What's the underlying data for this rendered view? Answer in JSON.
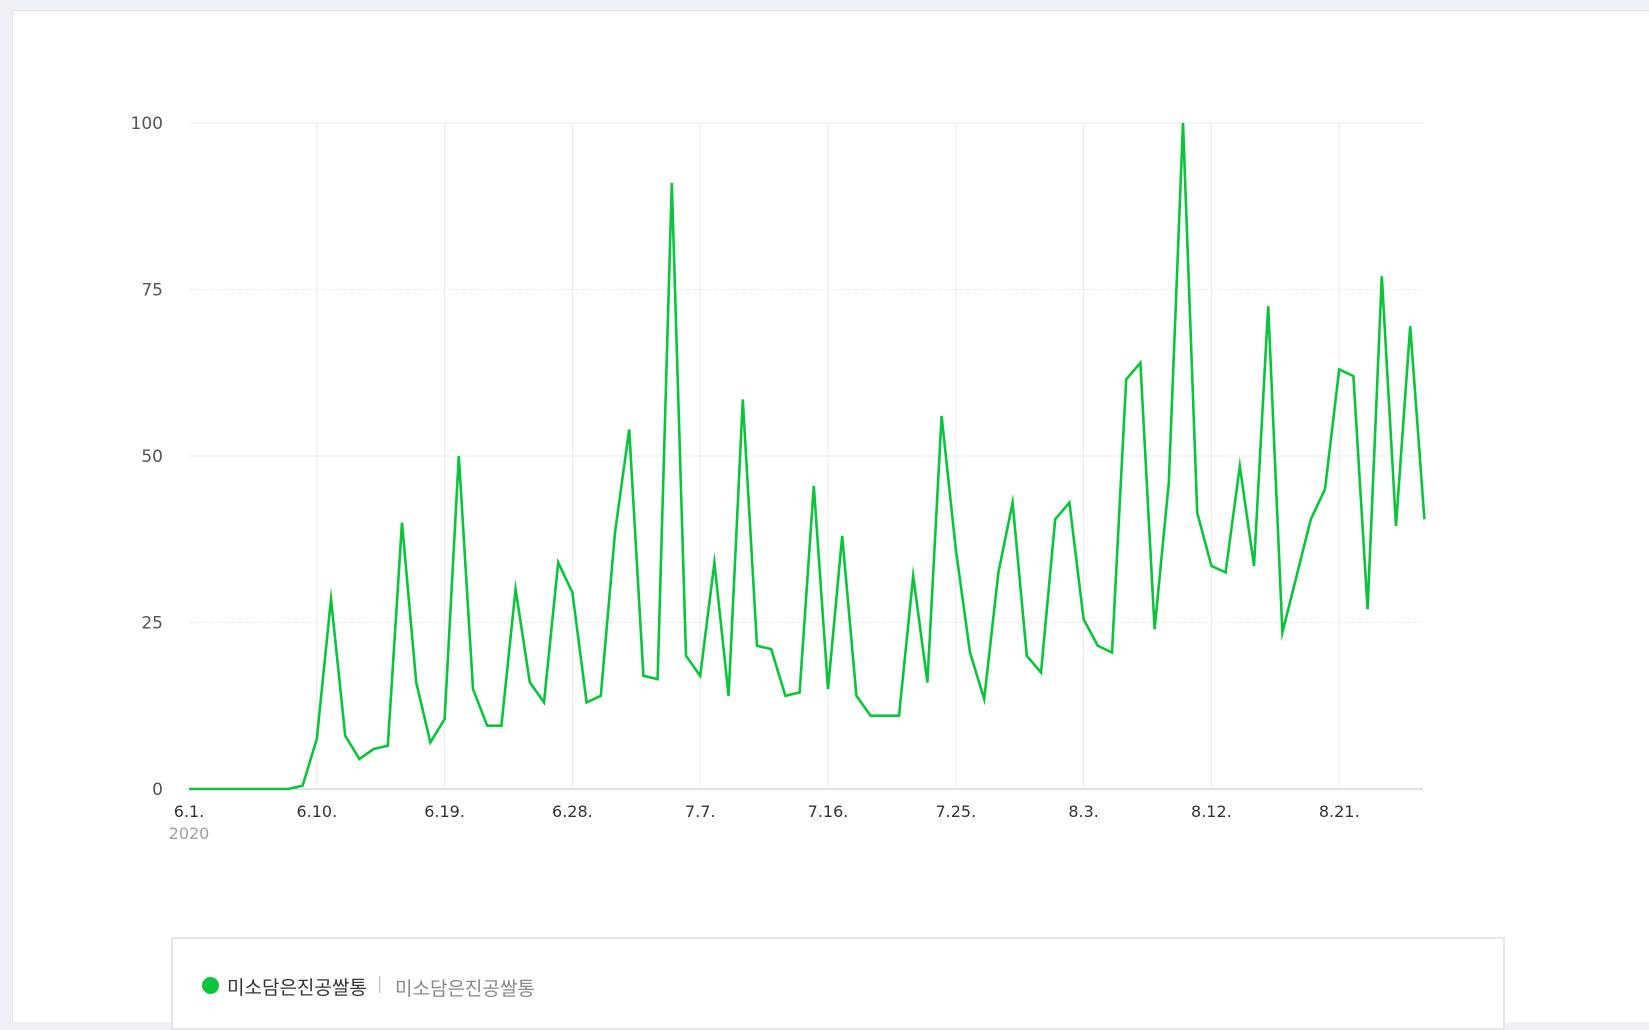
{
  "chart_data": {
    "type": "line",
    "x_start": "2020-06-01",
    "x_ticks": [
      "6.1.",
      "6.10.",
      "6.19.",
      "6.28.",
      "7.7.",
      "7.16.",
      "7.25.",
      "8.3.",
      "8.12.",
      "8.21."
    ],
    "x_year_label": "2020",
    "y_ticks": [
      "0",
      "25",
      "50",
      "75",
      "100"
    ],
    "ylim": [
      0,
      100
    ],
    "grid": true,
    "legend_position": "bottom",
    "series": [
      {
        "name": "미소담은진공쌀통",
        "color": "#0ac53c",
        "values": [
          0,
          0,
          0,
          0,
          0,
          0,
          0,
          0,
          0.5,
          7.5,
          28.5,
          8,
          4.5,
          6,
          6.5,
          40,
          16,
          7,
          10.5,
          50,
          15,
          9.5,
          9.5,
          30,
          16,
          13,
          34,
          29.5,
          13,
          14,
          38.5,
          54,
          17,
          16.5,
          91,
          20,
          17,
          34,
          14,
          58.5,
          21.5,
          21,
          14,
          14.5,
          45.5,
          15,
          38,
          14,
          11,
          11,
          11,
          32,
          16,
          56,
          36,
          20.5,
          13.5,
          32.5,
          43,
          20,
          17.5,
          40.5,
          43,
          25.5,
          21.5,
          20.5,
          61.5,
          64,
          24,
          46,
          100,
          41.5,
          33.5,
          32.5,
          48.5,
          33.5,
          72.5,
          23.5,
          32,
          40.5,
          45,
          63,
          62,
          27,
          77,
          39.5,
          69.5,
          40.5
        ]
      }
    ]
  },
  "legend": {
    "name": "미소담은진공쌀통",
    "separator": "|",
    "sub": "미소담은진공쌀통",
    "dot_color": "#0ac53c"
  }
}
